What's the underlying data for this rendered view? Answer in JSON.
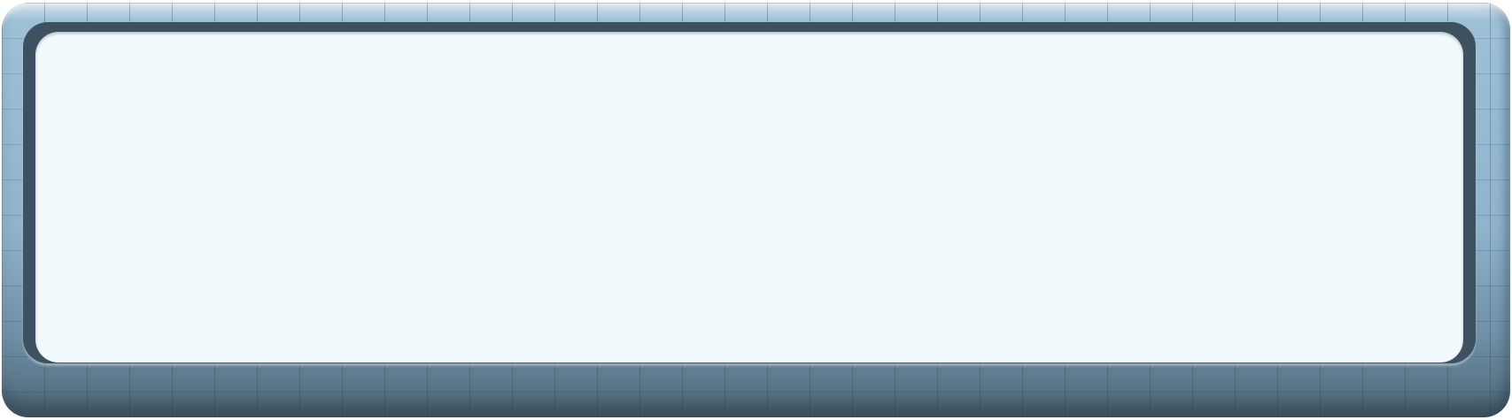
{
  "frame": {
    "style": "stone-brick",
    "colors": {
      "stone_light": "#9fc2d9",
      "stone_dark": "#4d6778",
      "rim": "#3d5160",
      "panel": "#f2fafd"
    }
  },
  "panel": {
    "text": ""
  }
}
